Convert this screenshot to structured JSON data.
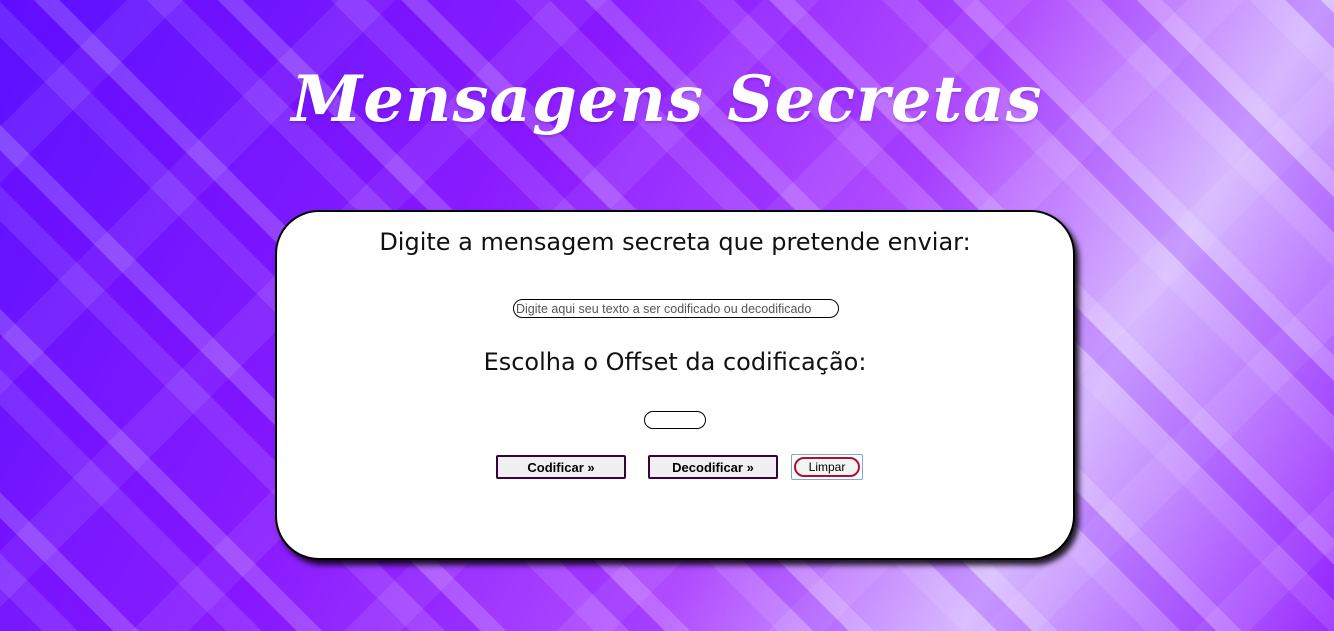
{
  "header": {
    "title": "Mensagens Secretas"
  },
  "form": {
    "message_label": "Digite a mensagem secreta que pretende enviar:",
    "message_input": {
      "value": "",
      "placeholder": "Digite aqui seu texto a ser codificado ou decodificado"
    },
    "offset_label": "Escolha o Offset da codificação:",
    "offset_input": {
      "value": "",
      "placeholder": ""
    },
    "buttons": {
      "encode": "Codificar »",
      "decode": "Decodificar »",
      "clear": "Limpar"
    }
  },
  "colors": {
    "background_primary": "#7a12ff",
    "card_background": "#ffffff",
    "button_border": "#3a0040",
    "clear_button_border": "#b0102a"
  }
}
